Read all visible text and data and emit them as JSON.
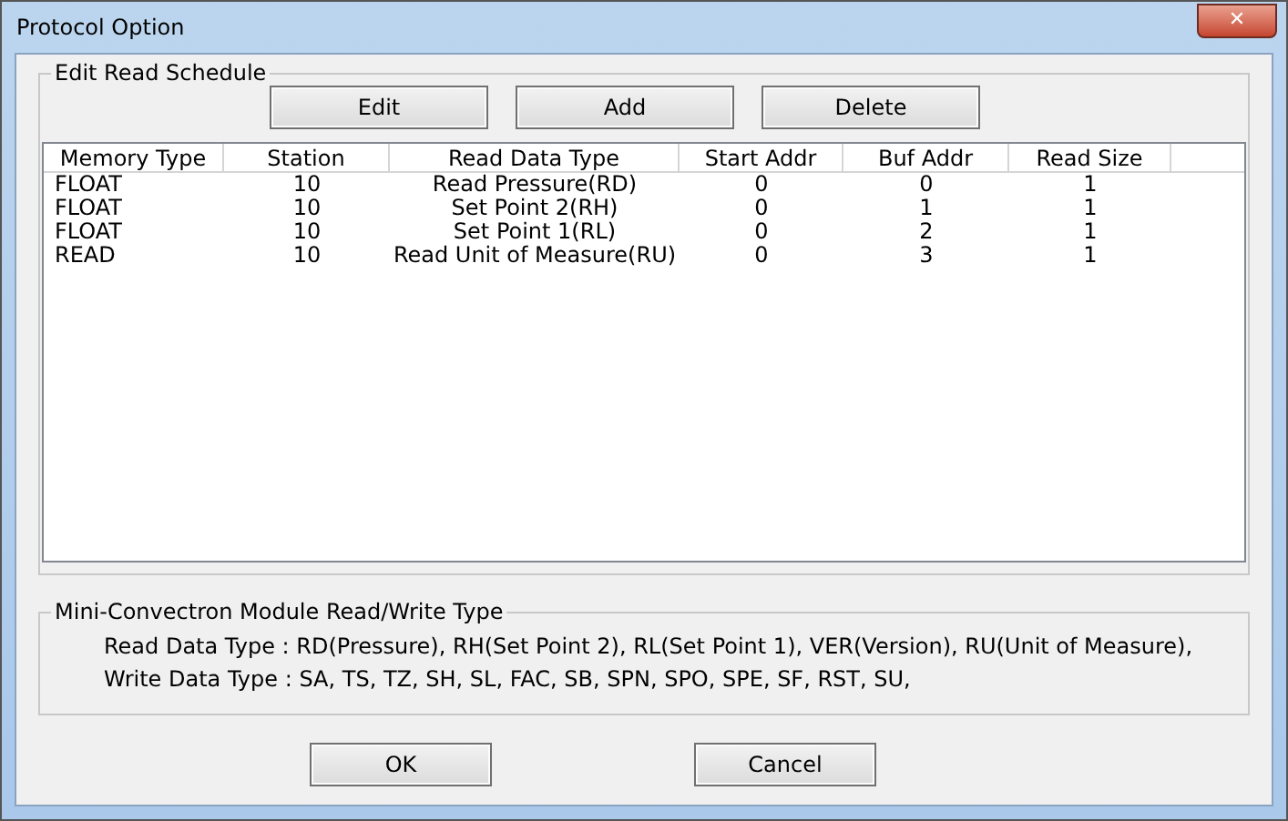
{
  "window": {
    "title": "Protocol Option",
    "close": "✕"
  },
  "schedule": {
    "title": "Edit Read Schedule",
    "buttons": [
      "Edit",
      "Add",
      "Delete"
    ],
    "columns": [
      "Memory Type",
      "Station",
      "Read Data Type",
      "Start Addr",
      "Buf Addr",
      "Read Size"
    ],
    "rows": [
      [
        "FLOAT",
        "10",
        "Read Pressure(RD)",
        "0",
        "0",
        "1"
      ],
      [
        "FLOAT",
        "10",
        "Set Point 2(RH)",
        "0",
        "1",
        "1"
      ],
      [
        "FLOAT",
        "10",
        "Set Point 1(RL)",
        "0",
        "2",
        "1"
      ],
      [
        "READ",
        "10",
        "Read Unit of Measure(RU)",
        "0",
        "3",
        "1"
      ]
    ]
  },
  "types": {
    "title": "Mini-Convectron Module Read/Write Type",
    "lines": [
      "Read Data Type : RD(Pressure), RH(Set Point 2), RL(Set Point 1), VER(Version), RU(Unit of Measure),",
      "Write Data Type : SA, TS, TZ, SH, SL, FAC, SB, SPN, SPO, SPE, SF, RST, SU,"
    ]
  },
  "buttons": [
    "OK",
    "Cancel"
  ]
}
